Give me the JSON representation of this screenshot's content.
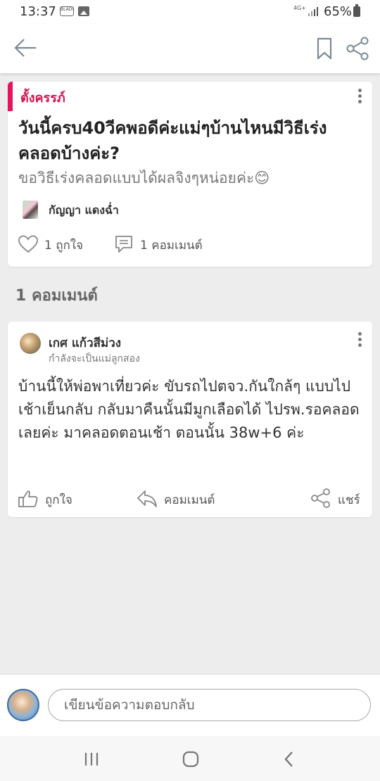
{
  "status_bar": {
    "time": "13:37",
    "badge_text": "BLADY",
    "network": "4G+",
    "battery": "65%",
    "icons": [
      "gallery-icon",
      "signal-icon",
      "battery-icon"
    ]
  },
  "top_bar": {
    "icons": [
      "back-arrow-icon",
      "bookmark-icon",
      "share-icon"
    ]
  },
  "post": {
    "category": "ตั้งครรภ์",
    "title": "วันนี้ครบ40วีคพอดีค่ะแม่ๆบ้านไหนมีวิธีเร่งคลอดบ้างค่ะ?",
    "description": "ขอวิธีเร่งคลอดแบบได้ผลจิงๆหน่อยค่ะ😊",
    "author": "กัญญา แดงฉ่ำ",
    "like_label": "1 ถูกใจ",
    "comment_label": "1 คอมเมนต์"
  },
  "comments_section": {
    "heading": "1 คอมเมนต์"
  },
  "comments": [
    {
      "author": "เกศ แก้วสีม่วง",
      "status": "กำลังจะเป็นแม่ลูกสอง",
      "body": "บ้านนี้ให้พ่อพาเที่ยวค่ะ ขับรถไปตจว.กันใกล้ๆ แบบไปเช้าเย็นกลับ กลับมาคืนนั้นมีมูกเลือดได้ ไปรพ.รอคลอดเลยค่ะ มาคลอดตอนเช้า ตอนนั้น 38w+6 ค่ะ",
      "like_label": "ถูกใจ",
      "reply_label": "คอมเมนต์",
      "share_label": "แชร์"
    }
  ],
  "reply_box": {
    "placeholder": "เขียนข้อความตอบกลับ"
  },
  "nav_bar": {
    "icons": [
      "recent-apps-icon",
      "home-icon",
      "back-nav-icon"
    ]
  },
  "colors": {
    "accent": "#e8145a",
    "category_text": "#d0164f",
    "background": "#ededed"
  }
}
